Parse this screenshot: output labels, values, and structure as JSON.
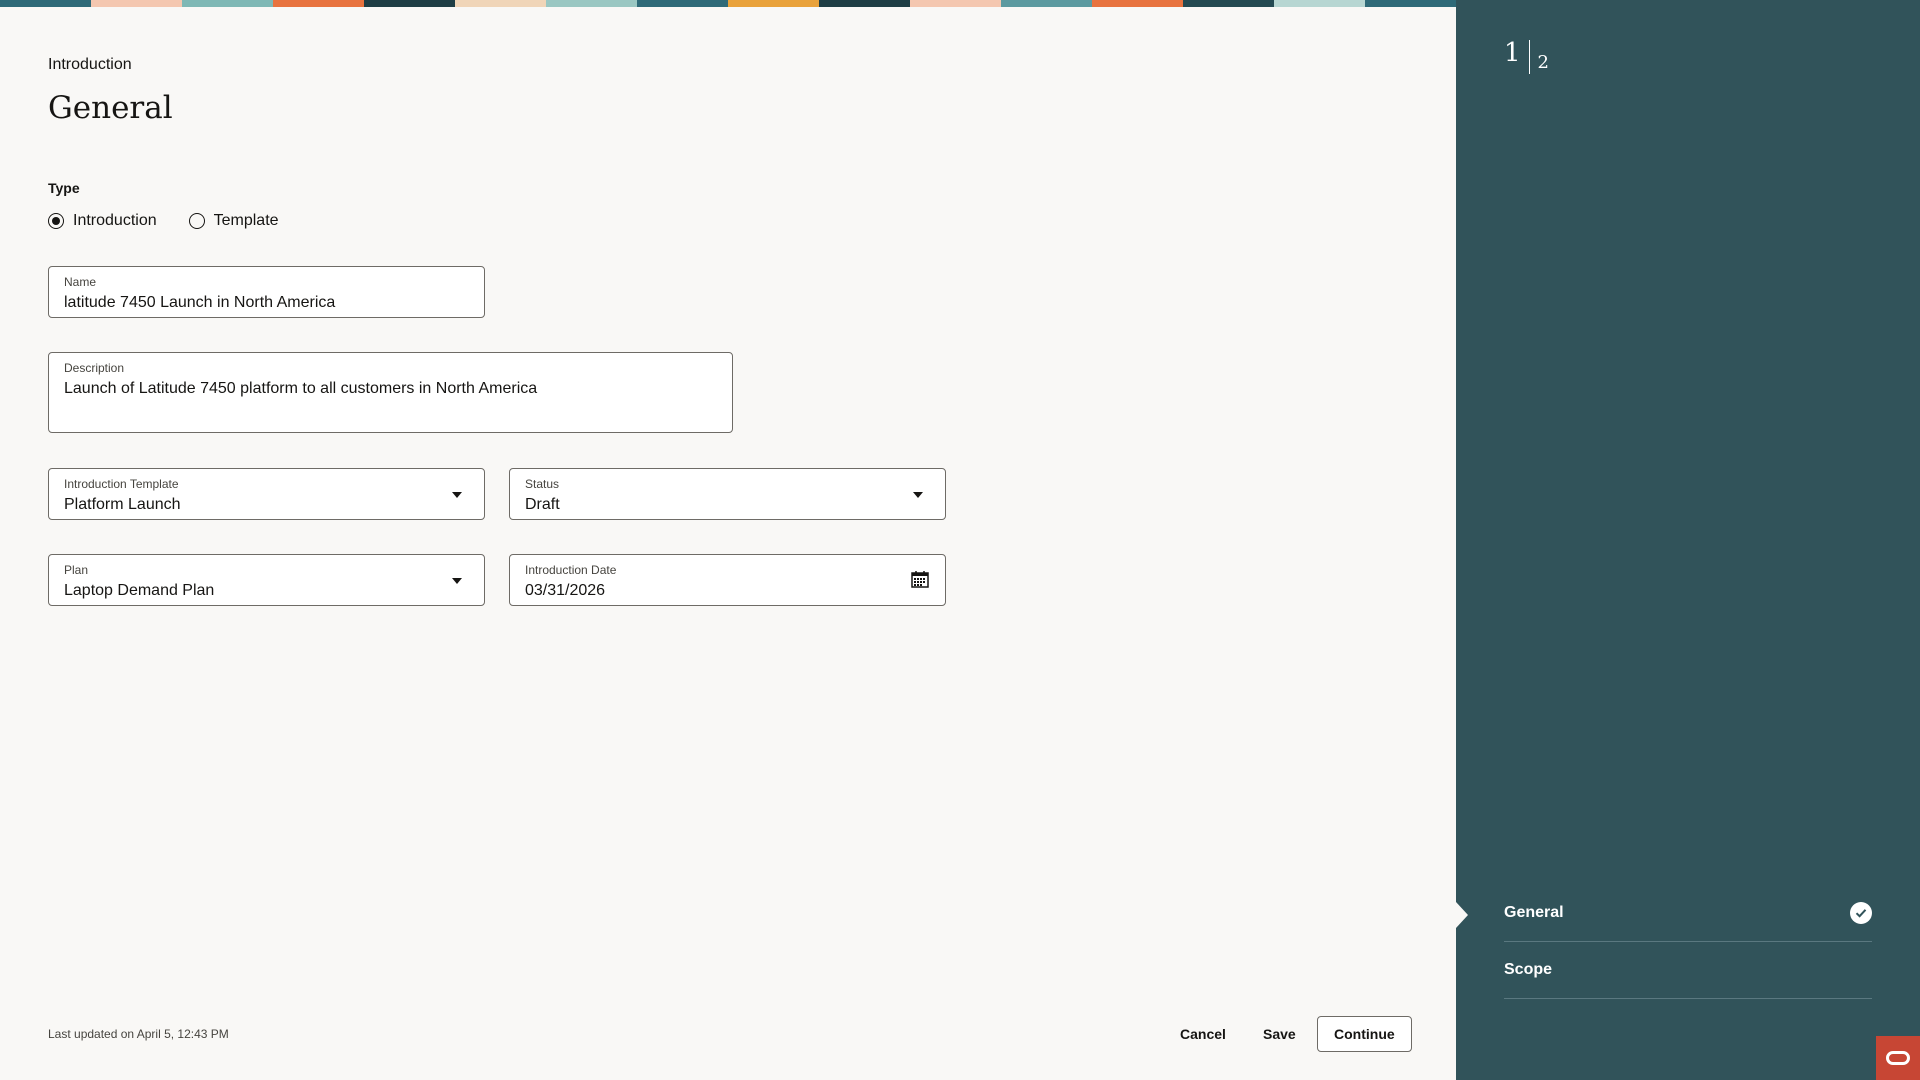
{
  "colors": {
    "sidebar_bg": "#31535a",
    "page_bg": "#f9f8f6",
    "brand_badge": "#c74634",
    "banner": [
      "#2f6a78",
      "#f4c7b0",
      "#7fb8b5",
      "#e8733f",
      "#1f3e45",
      "#f0d5b8",
      "#9ac7c2",
      "#2f6a78",
      "#e9a23b",
      "#1f3e45",
      "#f4c7b0",
      "#5c9aa0",
      "#e8733f",
      "#244a52",
      "#b7d6d2",
      "#2f6a78"
    ]
  },
  "header": {
    "eyebrow": "Introduction",
    "title": "General"
  },
  "form": {
    "type_label": "Type",
    "type_options": [
      {
        "label": "Introduction",
        "selected": true
      },
      {
        "label": "Template",
        "selected": false
      }
    ],
    "name": {
      "label": "Name",
      "value": "latitude 7450 Launch in North America"
    },
    "description": {
      "label": "Description",
      "value": "Launch of Latitude 7450 platform to all customers in North America"
    },
    "introduction_template": {
      "label": "Introduction Template",
      "value": "Platform Launch"
    },
    "status": {
      "label": "Status",
      "value": "Draft"
    },
    "plan": {
      "label": "Plan",
      "value": "Laptop Demand Plan"
    },
    "introduction_date": {
      "label": "Introduction Date",
      "value": "03/31/2026"
    }
  },
  "footer": {
    "last_updated": "Last updated on April 5, 12:43 PM",
    "cancel_label": "Cancel",
    "save_label": "Save",
    "continue_label": "Continue"
  },
  "sidebar": {
    "current_step": "1",
    "total_steps": "2",
    "steps": [
      {
        "label": "General",
        "completed": true,
        "icon": "check-circle-icon"
      },
      {
        "label": "Scope",
        "completed": false
      }
    ]
  },
  "brand": {
    "icon": "oracle-logo-icon"
  }
}
